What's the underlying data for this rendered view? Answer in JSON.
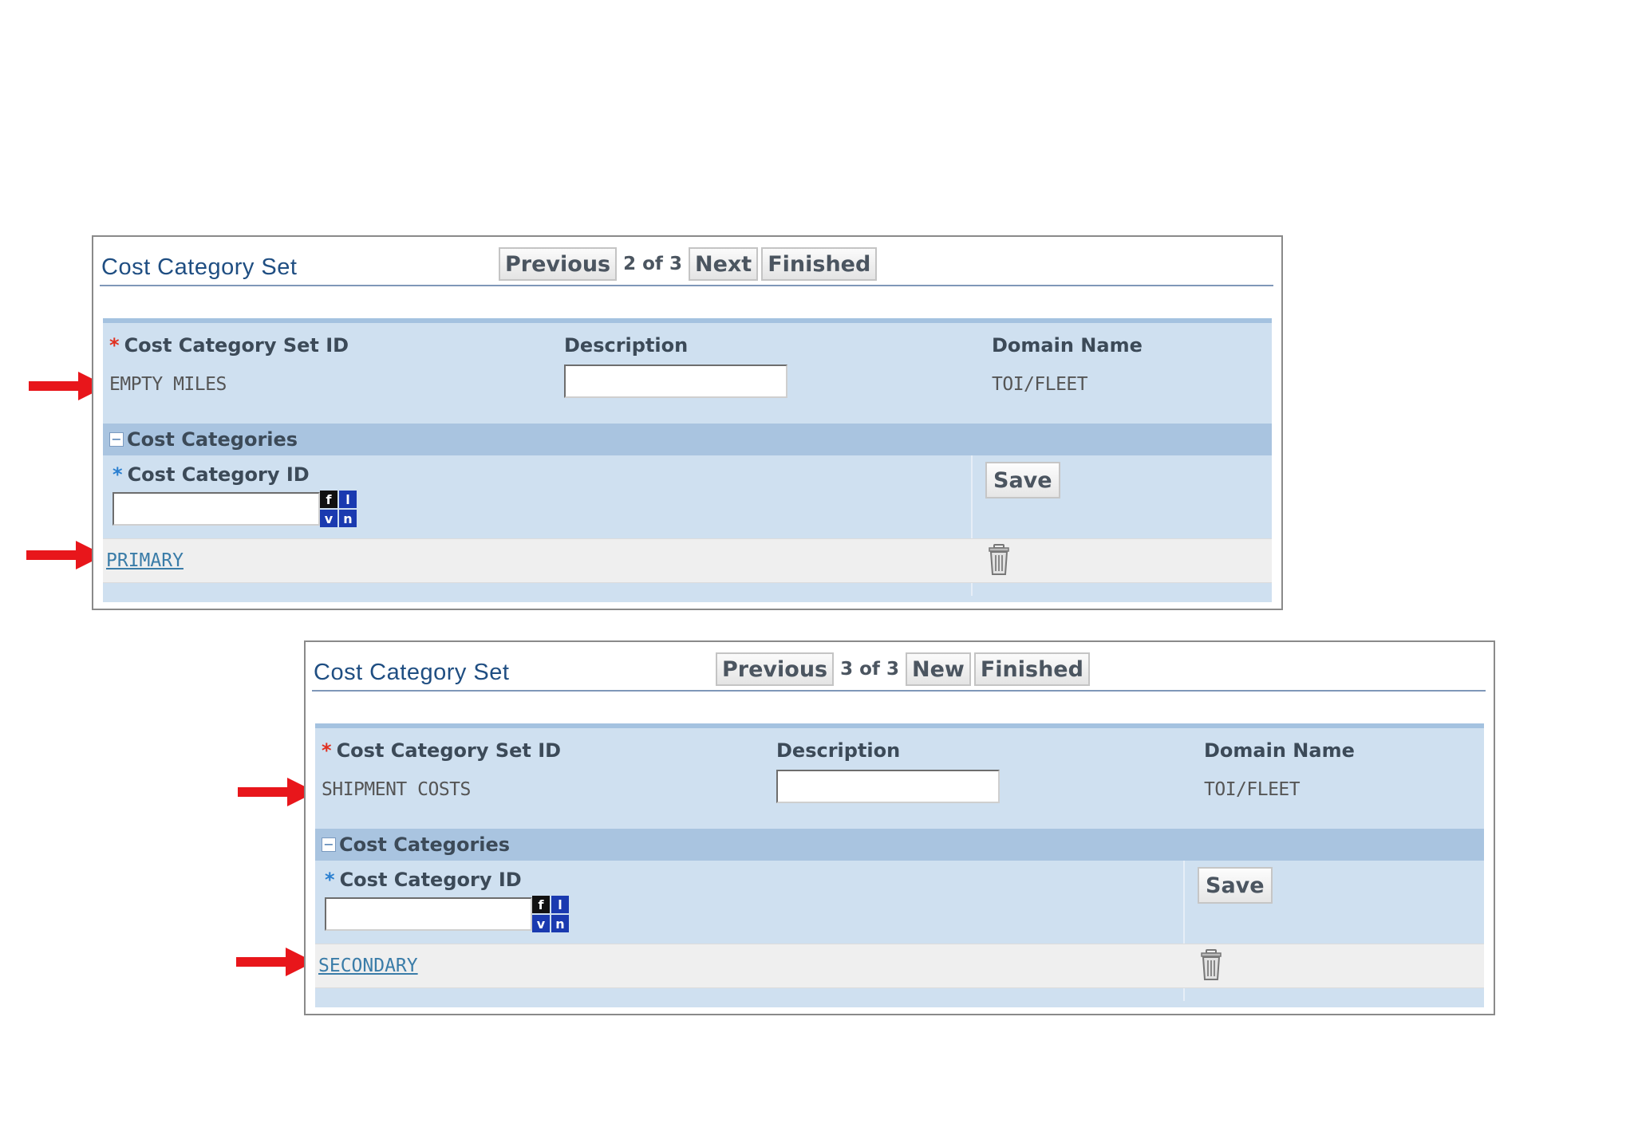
{
  "panels": [
    {
      "title": "Cost Category Set",
      "nav": {
        "previous": "Previous",
        "indicator": "2 of 3",
        "next": "Next",
        "finished": "Finished"
      },
      "fields": {
        "set_id_label": "Cost Category Set ID",
        "set_id_value": "EMPTY MILES",
        "description_label": "Description",
        "description_value": "",
        "domain_label": "Domain Name",
        "domain_value": "TOI/FLEET"
      },
      "categories": {
        "section_title": "Cost Categories",
        "collapse_symbol": "−",
        "cost_category_id_label": "Cost Category ID",
        "lov_letters": [
          "f",
          "l",
          "v",
          "n"
        ],
        "save_label": "Save",
        "rows": [
          {
            "value": "PRIMARY"
          }
        ]
      }
    },
    {
      "title": "Cost Category Set",
      "nav": {
        "previous": "Previous",
        "indicator": "3 of 3",
        "next": "New",
        "finished": "Finished"
      },
      "fields": {
        "set_id_label": "Cost Category Set ID",
        "set_id_value": "SHIPMENT COSTS",
        "description_label": "Description",
        "description_value": "",
        "domain_label": "Domain Name",
        "domain_value": "TOI/FLEET"
      },
      "categories": {
        "section_title": "Cost Categories",
        "collapse_symbol": "−",
        "cost_category_id_label": "Cost Category ID",
        "lov_letters": [
          "f",
          "l",
          "v",
          "n"
        ],
        "save_label": "Save",
        "rows": [
          {
            "value": "SECONDARY"
          }
        ]
      }
    }
  ],
  "required_marker": "*",
  "colors": {
    "arrow": "#e8161b",
    "link": "#3a7ca8",
    "panel_bg": "#cfe0f0",
    "header_bg": "#a9c4e0",
    "title": "#1f4e82"
  },
  "icons": {
    "trash": "trash-icon",
    "lov": "list-of-values-icon",
    "arrow": "red-arrow-icon"
  }
}
